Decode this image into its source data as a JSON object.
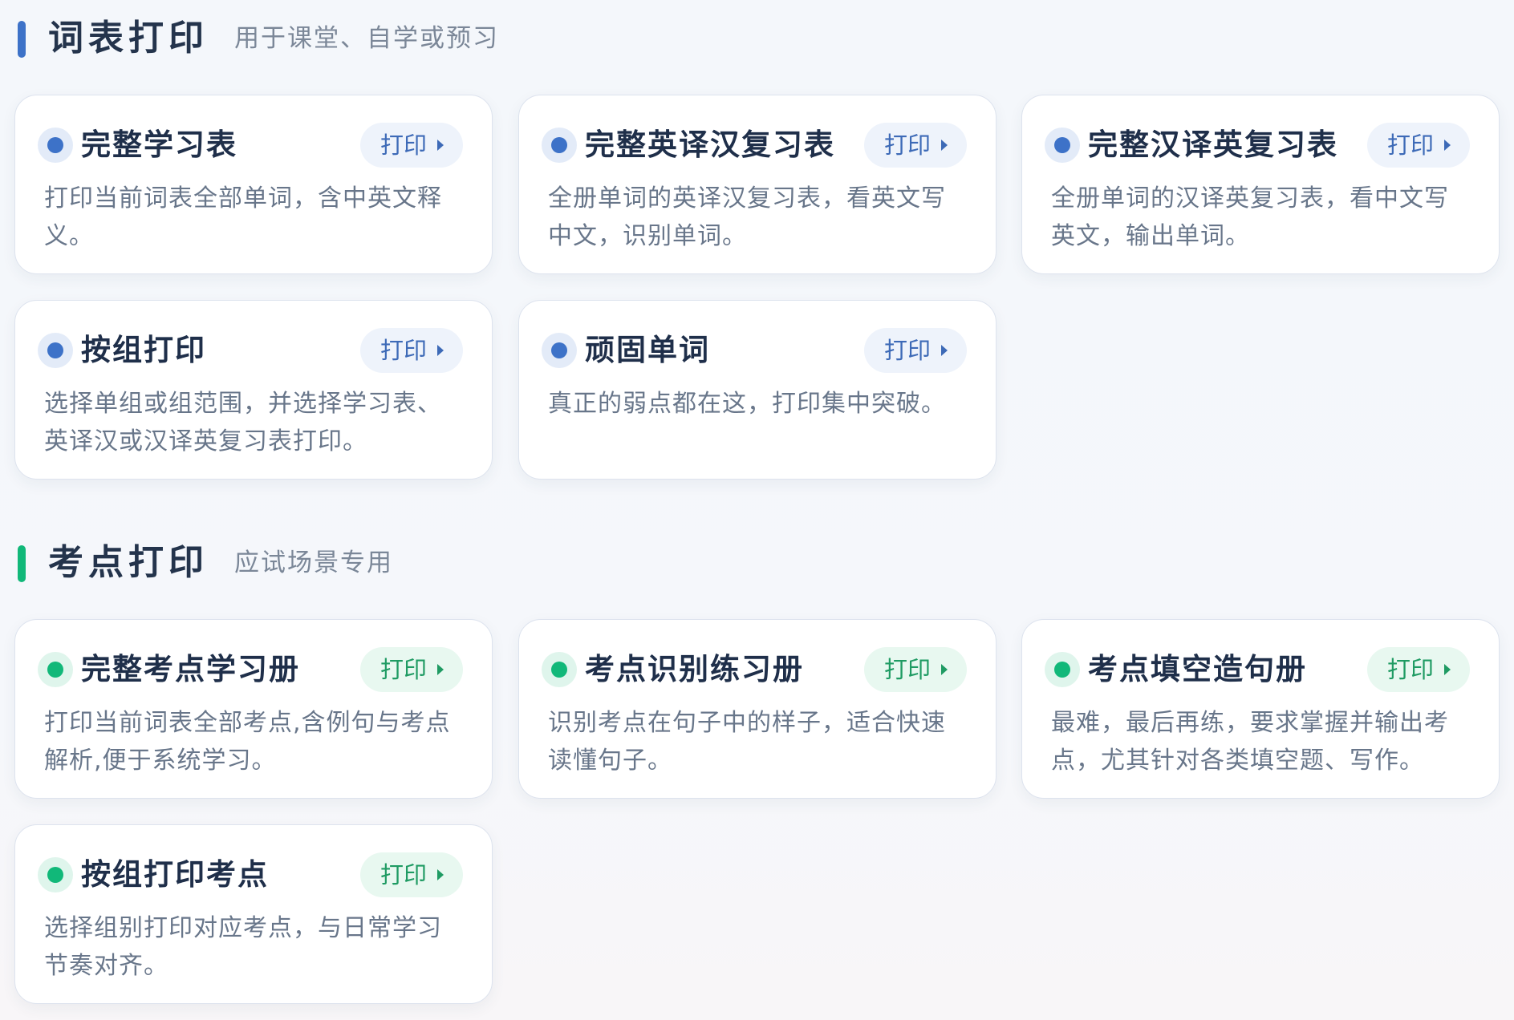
{
  "sections": [
    {
      "title": "词表打印",
      "subtitle": "用于课堂、自学或预习",
      "color": "#3d72c8",
      "cards": [
        {
          "title": "完整学习表",
          "button": "打印",
          "desc": "打印当前词表全部单词，含中英文释义。"
        },
        {
          "title": "完整英译汉复习表",
          "button": "打印",
          "desc": "全册单词的英译汉复习表，看英文写中文，识别单词。"
        },
        {
          "title": "完整汉译英复习表",
          "button": "打印",
          "desc": "全册单词的汉译英复习表，看中文写英文，输出单词。"
        },
        {
          "title": "按组打印",
          "button": "打印",
          "desc": "选择单组或组范围，并选择学习表、英译汉或汉译英复习表打印。"
        },
        {
          "title": "顽固单词",
          "button": "打印",
          "desc": "真正的弱点都在这，打印集中突破。"
        }
      ]
    },
    {
      "title": "考点打印",
      "subtitle": "应试场景专用",
      "color": "#11b879",
      "cards": [
        {
          "title": "完整考点学习册",
          "button": "打印",
          "desc": "打印当前词表全部考点,含例句与考点解析,便于系统学习。"
        },
        {
          "title": "考点识别练习册",
          "button": "打印",
          "desc": "识别考点在句子中的样子，适合快速读懂句子。"
        },
        {
          "title": "考点填空造句册",
          "button": "打印",
          "desc": "最难，最后再练，要求掌握并输出考点，尤其针对各类填空题、写作。"
        },
        {
          "title": "按组打印考点",
          "button": "打印",
          "desc": "选择组别打印对应考点，与日常学习节奏对齐。"
        }
      ]
    }
  ]
}
